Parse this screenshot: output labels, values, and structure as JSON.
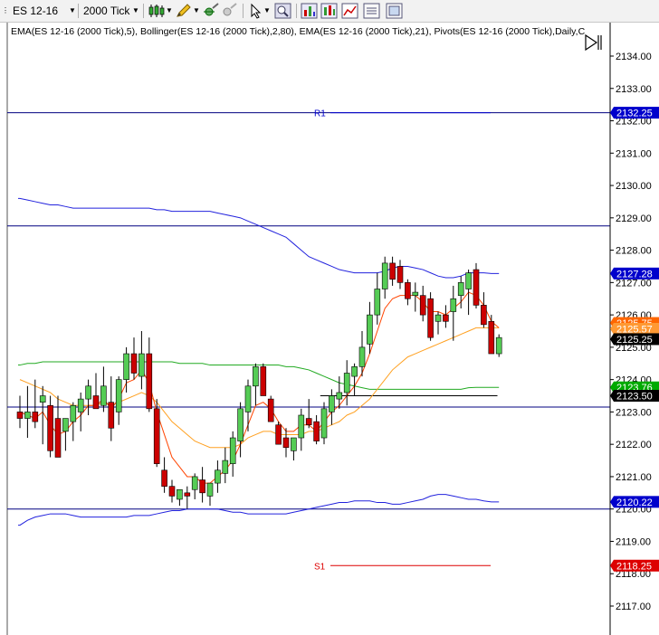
{
  "toolbar": {
    "instrument": "ES 12-16",
    "interval": "2000 Tick",
    "icons": [
      "candlestick-icon",
      "pencil-icon",
      "crosshair-icon",
      "zoom-icon",
      "pointer-icon",
      "magnifier-icon",
      "bar-chart-icon",
      "indicator-icon",
      "strategy-icon",
      "properties-icon"
    ]
  },
  "indicators_text": "EMA(ES 12-16 (2000 Tick),5), Bollinger(ES 12-16 (2000 Tick),2,80), EMA(ES 12-16 (2000 Tick),21), Pivots(ES 12-16 (2000 Tick),Daily,C",
  "price_axis": {
    "ticks": [
      "2134.00",
      "2133.00",
      "2132.00",
      "2131.00",
      "2130.00",
      "2129.00",
      "2128.00",
      "2127.00",
      "2126.00",
      "2125.00",
      "2124.00",
      "2123.00",
      "2122.00",
      "2121.00",
      "2120.00",
      "2119.00",
      "2118.00",
      "2117.00"
    ]
  },
  "price_tags": [
    {
      "text": "2132.25",
      "bg": "#0000cc",
      "fg": "#ffffff"
    },
    {
      "text": "2127.28",
      "bg": "#0000cc",
      "fg": "#ffffff"
    },
    {
      "text": "2125.75",
      "bg": "#ff6600",
      "fg": "#ffffff"
    },
    {
      "text": "2125.57",
      "bg": "#ff9933",
      "fg": "#ffffff"
    },
    {
      "text": "2125.25",
      "bg": "#000000",
      "fg": "#ffffff"
    },
    {
      "text": "2123.76",
      "bg": "#00aa00",
      "fg": "#ffffff"
    },
    {
      "text": "2123.50",
      "bg": "#000000",
      "fg": "#ffffff"
    },
    {
      "text": "2120.22",
      "bg": "#0000cc",
      "fg": "#ffffff"
    },
    {
      "text": "2118.25",
      "bg": "#dd0000",
      "fg": "#ffffff"
    }
  ],
  "pivots": [
    {
      "label": "R1",
      "price": 2132.25,
      "color": "#0000cc"
    },
    {
      "label": "S1",
      "price": 2118.25,
      "color": "#dd0000"
    }
  ],
  "colors": {
    "up": "#55cc55",
    "down": "#cc0000",
    "ema5": "#ff4400",
    "ema21": "#ffa020",
    "bollinger": "#2222dd",
    "bollinger_mid": "#22aa22",
    "hline": "#000080",
    "axis_bg": "#ffffff"
  },
  "chart_data": {
    "type": "candlestick",
    "y_range": [
      2116.5,
      2134.8
    ],
    "candles": [
      {
        "o": 2123.0,
        "h": 2123.5,
        "l": 2122.5,
        "c": 2122.8
      },
      {
        "o": 2122.8,
        "h": 2123.8,
        "l": 2122.2,
        "c": 2123.0
      },
      {
        "o": 2123.0,
        "h": 2124.0,
        "l": 2122.5,
        "c": 2122.7
      },
      {
        "o": 2123.3,
        "h": 2123.8,
        "l": 2122.0,
        "c": 2123.5
      },
      {
        "o": 2123.2,
        "h": 2123.5,
        "l": 2121.6,
        "c": 2121.8
      },
      {
        "o": 2122.8,
        "h": 2123.5,
        "l": 2121.6,
        "c": 2121.6
      },
      {
        "o": 2122.4,
        "h": 2122.8,
        "l": 2121.8,
        "c": 2122.8
      },
      {
        "o": 2122.7,
        "h": 2123.3,
        "l": 2122.1,
        "c": 2123.2
      },
      {
        "o": 2123.0,
        "h": 2123.6,
        "l": 2122.4,
        "c": 2123.4
      },
      {
        "o": 2123.4,
        "h": 2124.0,
        "l": 2122.9,
        "c": 2123.8
      },
      {
        "o": 2123.5,
        "h": 2124.2,
        "l": 2123.2,
        "c": 2123.1
      },
      {
        "o": 2123.2,
        "h": 2124.4,
        "l": 2123.0,
        "c": 2123.8
      },
      {
        "o": 2123.3,
        "h": 2124.1,
        "l": 2122.1,
        "c": 2122.5
      },
      {
        "o": 2123.0,
        "h": 2124.1,
        "l": 2122.6,
        "c": 2124.0
      },
      {
        "o": 2124.0,
        "h": 2125.0,
        "l": 2123.6,
        "c": 2124.8
      },
      {
        "o": 2124.8,
        "h": 2125.3,
        "l": 2124.0,
        "c": 2124.2
      },
      {
        "o": 2124.1,
        "h": 2125.5,
        "l": 2123.7,
        "c": 2124.8
      },
      {
        "o": 2124.8,
        "h": 2125.3,
        "l": 2123.0,
        "c": 2123.1
      },
      {
        "o": 2123.1,
        "h": 2123.4,
        "l": 2121.3,
        "c": 2121.4
      },
      {
        "o": 2121.2,
        "h": 2121.6,
        "l": 2120.5,
        "c": 2120.7
      },
      {
        "o": 2120.7,
        "h": 2120.9,
        "l": 2120.2,
        "c": 2120.4
      },
      {
        "o": 2120.3,
        "h": 2120.6,
        "l": 2120.1,
        "c": 2120.6
      },
      {
        "o": 2120.5,
        "h": 2120.7,
        "l": 2120.0,
        "c": 2120.4
      },
      {
        "o": 2120.6,
        "h": 2121.1,
        "l": 2120.3,
        "c": 2121.0
      },
      {
        "o": 2120.9,
        "h": 2121.3,
        "l": 2120.2,
        "c": 2120.5
      },
      {
        "o": 2120.4,
        "h": 2120.8,
        "l": 2120.1,
        "c": 2120.8
      },
      {
        "o": 2120.8,
        "h": 2121.5,
        "l": 2120.5,
        "c": 2121.2
      },
      {
        "o": 2121.1,
        "h": 2121.9,
        "l": 2120.8,
        "c": 2121.5
      },
      {
        "o": 2121.4,
        "h": 2122.4,
        "l": 2121.0,
        "c": 2122.2
      },
      {
        "o": 2122.1,
        "h": 2123.3,
        "l": 2121.6,
        "c": 2123.1
      },
      {
        "o": 2123.0,
        "h": 2124.0,
        "l": 2122.4,
        "c": 2123.8
      },
      {
        "o": 2123.8,
        "h": 2124.5,
        "l": 2123.2,
        "c": 2124.4
      },
      {
        "o": 2124.4,
        "h": 2124.5,
        "l": 2123.5,
        "c": 2123.5
      },
      {
        "o": 2123.4,
        "h": 2123.5,
        "l": 2122.8,
        "c": 2122.7
      },
      {
        "o": 2122.6,
        "h": 2122.7,
        "l": 2122.0,
        "c": 2122.0
      },
      {
        "o": 2122.2,
        "h": 2122.5,
        "l": 2121.6,
        "c": 2121.9
      },
      {
        "o": 2121.8,
        "h": 2122.2,
        "l": 2121.5,
        "c": 2122.2
      },
      {
        "o": 2122.2,
        "h": 2123.1,
        "l": 2121.8,
        "c": 2122.9
      },
      {
        "o": 2122.8,
        "h": 2123.4,
        "l": 2122.5,
        "c": 2122.6
      },
      {
        "o": 2122.7,
        "h": 2122.9,
        "l": 2122.0,
        "c": 2122.1
      },
      {
        "o": 2122.2,
        "h": 2123.3,
        "l": 2122.0,
        "c": 2123.1
      },
      {
        "o": 2123.0,
        "h": 2123.7,
        "l": 2122.6,
        "c": 2123.5
      },
      {
        "o": 2123.4,
        "h": 2124.1,
        "l": 2123.1,
        "c": 2123.6
      },
      {
        "o": 2123.6,
        "h": 2124.6,
        "l": 2123.2,
        "c": 2124.2
      },
      {
        "o": 2124.1,
        "h": 2124.5,
        "l": 2123.5,
        "c": 2124.4
      },
      {
        "o": 2124.4,
        "h": 2125.5,
        "l": 2124.1,
        "c": 2125.0
      },
      {
        "o": 2125.1,
        "h": 2126.4,
        "l": 2124.8,
        "c": 2126.0
      },
      {
        "o": 2126.0,
        "h": 2127.3,
        "l": 2125.7,
        "c": 2126.8
      },
      {
        "o": 2126.8,
        "h": 2127.8,
        "l": 2126.5,
        "c": 2127.6
      },
      {
        "o": 2127.6,
        "h": 2127.8,
        "l": 2126.9,
        "c": 2127.1
      },
      {
        "o": 2127.5,
        "h": 2127.7,
        "l": 2126.8,
        "c": 2127.0
      },
      {
        "o": 2127.0,
        "h": 2127.1,
        "l": 2126.3,
        "c": 2126.5
      },
      {
        "o": 2126.6,
        "h": 2127.0,
        "l": 2126.1,
        "c": 2126.7
      },
      {
        "o": 2126.6,
        "h": 2126.9,
        "l": 2125.8,
        "c": 2126.0
      },
      {
        "o": 2126.5,
        "h": 2126.7,
        "l": 2125.2,
        "c": 2125.3
      },
      {
        "o": 2125.8,
        "h": 2126.1,
        "l": 2125.4,
        "c": 2126.0
      },
      {
        "o": 2126.0,
        "h": 2126.3,
        "l": 2125.6,
        "c": 2125.8
      },
      {
        "o": 2126.1,
        "h": 2126.9,
        "l": 2125.2,
        "c": 2126.5
      },
      {
        "o": 2126.6,
        "h": 2127.2,
        "l": 2126.2,
        "c": 2127.0
      },
      {
        "o": 2126.8,
        "h": 2127.4,
        "l": 2126.0,
        "c": 2127.3
      },
      {
        "o": 2127.4,
        "h": 2127.6,
        "l": 2126.2,
        "c": 2126.3
      },
      {
        "o": 2126.3,
        "h": 2126.7,
        "l": 2125.6,
        "c": 2125.7
      },
      {
        "o": 2125.8,
        "h": 2126.0,
        "l": 2124.8,
        "c": 2124.8
      },
      {
        "o": 2124.8,
        "h": 2125.4,
        "l": 2124.7,
        "c": 2125.3
      }
    ],
    "ema5": [
      2123.0,
      2122.9,
      2122.8,
      2123.0,
      2122.6,
      2122.3,
      2122.4,
      2122.7,
      2122.9,
      2123.2,
      2123.2,
      2123.4,
      2123.1,
      2123.4,
      2123.9,
      2124.0,
      2124.3,
      2123.9,
      2123.0,
      2122.3,
      2121.6,
      2121.3,
      2121.0,
      2121.0,
      2120.8,
      2120.8,
      2121.0,
      2121.2,
      2121.5,
      2122.0,
      2122.6,
      2123.2,
      2123.3,
      2123.1,
      2122.7,
      2122.4,
      2122.4,
      2122.6,
      2122.6,
      2122.4,
      2122.7,
      2123.0,
      2123.2,
      2123.5,
      2123.8,
      2124.2,
      2124.8,
      2125.5,
      2126.2,
      2126.5,
      2126.6,
      2126.6,
      2126.6,
      2126.4,
      2126.1,
      2126.1,
      2126.0,
      2126.2,
      2126.4,
      2126.7,
      2126.6,
      2126.3,
      2125.8,
      2125.6
    ],
    "ema21": [
      2124.0,
      2123.9,
      2123.8,
      2123.7,
      2123.6,
      2123.4,
      2123.3,
      2123.2,
      2123.2,
      2123.2,
      2123.2,
      2123.3,
      2123.2,
      2123.3,
      2123.4,
      2123.5,
      2123.6,
      2123.5,
      2123.3,
      2123.0,
      2122.7,
      2122.5,
      2122.3,
      2122.1,
      2122.0,
      2121.9,
      2121.9,
      2121.9,
      2121.9,
      2122.0,
      2122.2,
      2122.3,
      2122.4,
      2122.4,
      2122.3,
      2122.3,
      2122.3,
      2122.3,
      2122.4,
      2122.4,
      2122.5,
      2122.6,
      2122.7,
      2122.9,
      2123.0,
      2123.2,
      2123.4,
      2123.7,
      2124.0,
      2124.3,
      2124.5,
      2124.7,
      2124.8,
      2124.9,
      2125.0,
      2125.1,
      2125.2,
      2125.3,
      2125.4,
      2125.5,
      2125.6,
      2125.6,
      2125.6,
      2125.6
    ],
    "bb_upper": [
      2129.6,
      2129.55,
      2129.5,
      2129.45,
      2129.4,
      2129.4,
      2129.35,
      2129.3,
      2129.3,
      2129.3,
      2129.3,
      2129.3,
      2129.3,
      2129.3,
      2129.3,
      2129.3,
      2129.3,
      2129.3,
      2129.25,
      2129.25,
      2129.2,
      2129.2,
      2129.2,
      2129.2,
      2129.2,
      2129.2,
      2129.15,
      2129.1,
      2129.05,
      2129.0,
      2128.9,
      2128.8,
      2128.7,
      2128.6,
      2128.5,
      2128.4,
      2128.2,
      2128.0,
      2127.8,
      2127.7,
      2127.6,
      2127.5,
      2127.4,
      2127.35,
      2127.3,
      2127.3,
      2127.3,
      2127.3,
      2127.35,
      2127.45,
      2127.5,
      2127.5,
      2127.45,
      2127.4,
      2127.3,
      2127.2,
      2127.15,
      2127.15,
      2127.2,
      2127.3,
      2127.3,
      2127.3,
      2127.28,
      2127.28
    ],
    "bb_mid": [
      2124.45,
      2124.5,
      2124.5,
      2124.55,
      2124.55,
      2124.55,
      2124.55,
      2124.55,
      2124.55,
      2124.55,
      2124.55,
      2124.55,
      2124.55,
      2124.55,
      2124.55,
      2124.55,
      2124.55,
      2124.55,
      2124.55,
      2124.55,
      2124.55,
      2124.5,
      2124.5,
      2124.5,
      2124.5,
      2124.45,
      2124.45,
      2124.45,
      2124.45,
      2124.45,
      2124.45,
      2124.45,
      2124.45,
      2124.45,
      2124.45,
      2124.4,
      2124.4,
      2124.35,
      2124.3,
      2124.2,
      2124.1,
      2124.0,
      2123.9,
      2123.85,
      2123.8,
      2123.75,
      2123.7,
      2123.7,
      2123.7,
      2123.7,
      2123.7,
      2123.7,
      2123.7,
      2123.7,
      2123.7,
      2123.7,
      2123.7,
      2123.7,
      2123.7,
      2123.75,
      2123.76,
      2123.76,
      2123.76,
      2123.76
    ],
    "bb_lower": [
      2119.5,
      2119.65,
      2119.75,
      2119.8,
      2119.85,
      2119.85,
      2119.85,
      2119.8,
      2119.75,
      2119.75,
      2119.75,
      2119.75,
      2119.75,
      2119.75,
      2119.75,
      2119.8,
      2119.8,
      2119.8,
      2119.85,
      2119.9,
      2119.95,
      2119.95,
      2120.0,
      2120.0,
      2120.0,
      2120.0,
      2120.0,
      2119.95,
      2119.9,
      2119.9,
      2119.85,
      2119.85,
      2119.85,
      2119.85,
      2119.85,
      2119.85,
      2119.9,
      2119.95,
      2120.0,
      2120.05,
      2120.1,
      2120.15,
      2120.2,
      2120.2,
      2120.25,
      2120.25,
      2120.25,
      2120.2,
      2120.2,
      2120.15,
      2120.15,
      2120.2,
      2120.25,
      2120.3,
      2120.4,
      2120.45,
      2120.45,
      2120.4,
      2120.35,
      2120.3,
      2120.3,
      2120.25,
      2120.22,
      2120.22
    ],
    "horizontal_lines": [
      2132.25,
      2128.75,
      2123.15,
      2120.0
    ],
    "last_close_line": 2123.5
  }
}
